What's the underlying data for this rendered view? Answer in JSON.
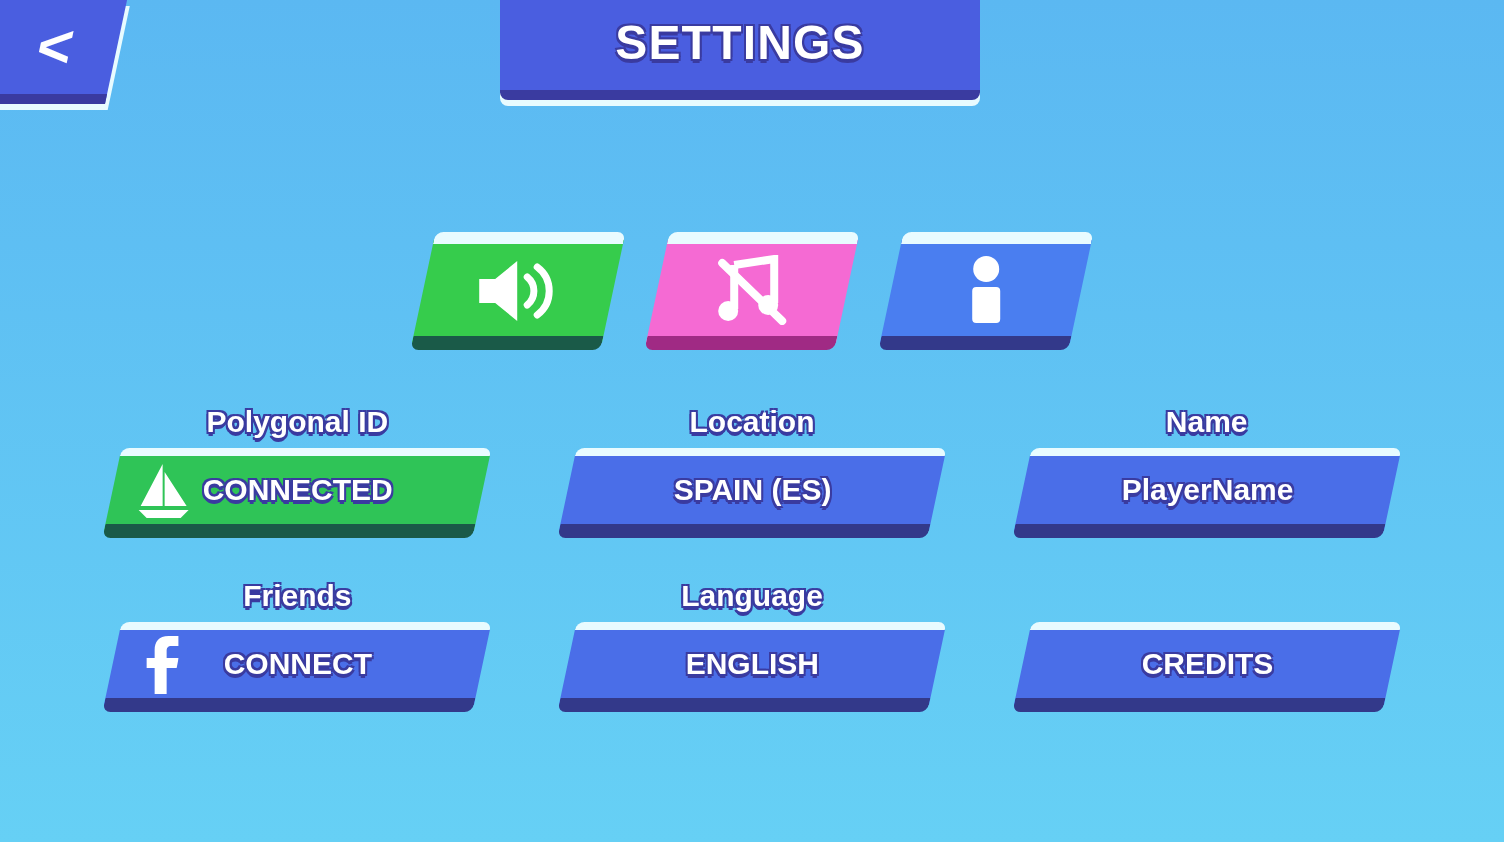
{
  "header": {
    "back_label": "<",
    "title": "SETTINGS"
  },
  "toggles": [
    {
      "kind": "sound",
      "on": true,
      "color": "#36cc4c"
    },
    {
      "kind": "music",
      "on": false,
      "color": "#f56ad3"
    },
    {
      "kind": "info",
      "color": "#4a7ef0"
    }
  ],
  "options": [
    {
      "label": "Polygonal ID",
      "value": "CONNECTED",
      "kind": "polygonal",
      "connected": true
    },
    {
      "label": "Location",
      "value": "SPAIN (ES)",
      "kind": "plain"
    },
    {
      "label": "Name",
      "value": "PlayerName",
      "kind": "plain"
    },
    {
      "label": "Friends",
      "value": "CONNECT",
      "kind": "facebook"
    },
    {
      "label": "Language",
      "value": "ENGLISH",
      "kind": "plain"
    },
    {
      "value": "CREDITS",
      "kind": "plain"
    }
  ]
}
